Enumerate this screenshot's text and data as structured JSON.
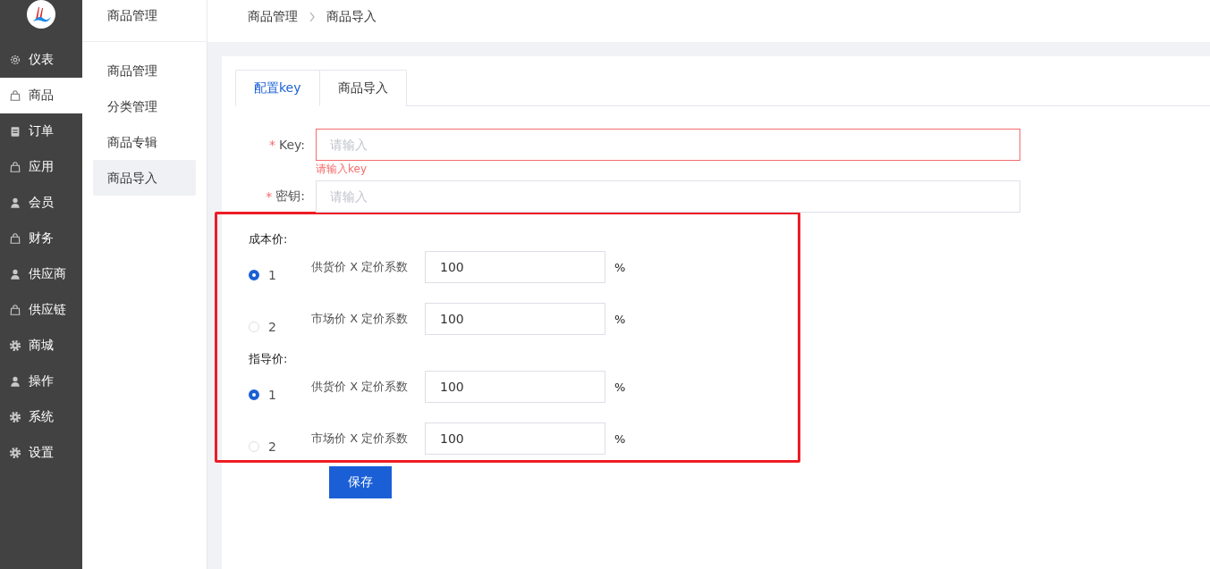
{
  "sidebar": {
    "items": [
      {
        "label": "仪表",
        "kind": "gear-outline",
        "selected": false
      },
      {
        "label": "商品",
        "kind": "bag",
        "selected": true
      },
      {
        "label": "订单",
        "kind": "clipboard",
        "selected": false
      },
      {
        "label": "应用",
        "kind": "bag",
        "selected": false
      },
      {
        "label": "会员",
        "kind": "person",
        "selected": false
      },
      {
        "label": "财务",
        "kind": "bag",
        "selected": false
      },
      {
        "label": "供应商",
        "kind": "person",
        "selected": false
      },
      {
        "label": "供应链",
        "kind": "bag",
        "selected": false
      },
      {
        "label": "商城",
        "kind": "gear",
        "selected": false
      },
      {
        "label": "操作",
        "kind": "person",
        "selected": false
      },
      {
        "label": "系统",
        "kind": "gear",
        "selected": false
      },
      {
        "label": "设置",
        "kind": "gear",
        "selected": false
      }
    ]
  },
  "submenu": {
    "title": "商品管理",
    "items": [
      {
        "label": "商品管理",
        "selected": false
      },
      {
        "label": "分类管理",
        "selected": false
      },
      {
        "label": "商品专辑",
        "selected": false
      },
      {
        "label": "商品导入",
        "selected": true
      }
    ]
  },
  "breadcrumb": [
    "商品管理",
    "商品导入"
  ],
  "tabs": [
    {
      "label": "配置key",
      "selected": true
    },
    {
      "label": "商品导入",
      "selected": false
    }
  ],
  "fields": [
    {
      "required_mark": "*",
      "label": "Key:",
      "placeholder": "请输入",
      "error": "请输入key"
    },
    {
      "required_mark": "*",
      "label": "密钥:",
      "placeholder": "请输入"
    }
  ],
  "price_groups": [
    {
      "title": "成本价:",
      "options": [
        {
          "label": "1",
          "selected": true,
          "formula": "供货价 X 定价系数",
          "value": "100",
          "unit": "%"
        },
        {
          "label": "2",
          "selected": false,
          "formula": "市场价 X 定价系数",
          "value": "100",
          "unit": "%"
        }
      ]
    },
    {
      "title": "指导价:",
      "options": [
        {
          "label": "1",
          "selected": true,
          "formula": "供货价 X 定价系数",
          "value": "100",
          "unit": "%"
        },
        {
          "label": "2",
          "selected": false,
          "formula": "市场价 X 定价系数",
          "value": "100",
          "unit": "%"
        }
      ]
    }
  ],
  "save_button": "保存"
}
